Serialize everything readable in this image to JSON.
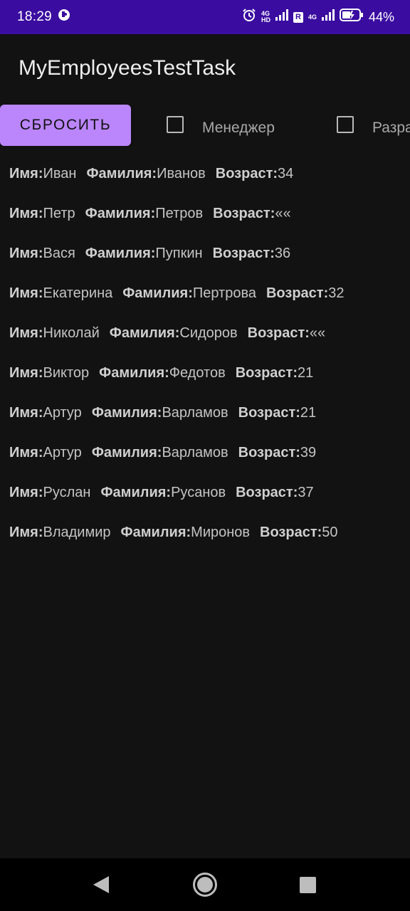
{
  "status_bar": {
    "time": "18:29",
    "network_1": "4G",
    "network_1_extra": "HD",
    "roaming_badge": "R",
    "network_2": "4G",
    "battery_percent": "44%"
  },
  "app_bar": {
    "title": "MyEmployeesTestTask"
  },
  "filters": {
    "reset_label": "СБРОСИТЬ",
    "manager_label": "Менеджер",
    "manager_checked": false,
    "developer_label": "Разработчик",
    "developer_checked": false
  },
  "labels": {
    "name": "Имя:",
    "surname": "Фамилия:",
    "age": "Возраст:"
  },
  "employees": [
    {
      "name": "Иван",
      "surname": "Иванов",
      "age": "34"
    },
    {
      "name": "Петр",
      "surname": "Петров",
      "age": "««"
    },
    {
      "name": "Вася",
      "surname": "Пупкин",
      "age": "36"
    },
    {
      "name": "Екатерина",
      "surname": "Пертрова",
      "age": "32"
    },
    {
      "name": "Николай",
      "surname": "Сидоров",
      "age": "««"
    },
    {
      "name": "Виктор",
      "surname": "Федотов",
      "age": "21"
    },
    {
      "name": "Артур",
      "surname": "Варламов",
      "age": "21"
    },
    {
      "name": "Артур",
      "surname": "Варламов",
      "age": "39"
    },
    {
      "name": "Руслан",
      "surname": "Русанов",
      "age": "37"
    },
    {
      "name": "Владимир",
      "surname": "Миронов",
      "age": "50"
    }
  ],
  "icons": {
    "status_notification": "notification-app-icon",
    "alarm": "alarm-icon",
    "signal": "signal-strength-icon",
    "battery": "battery-charging-icon",
    "nav_back": "back-icon",
    "nav_home": "home-icon",
    "nav_recents": "recents-icon"
  },
  "colors": {
    "status_bar": "#3a0ca0",
    "background": "#121212",
    "accent_button": "#bb86fc"
  }
}
